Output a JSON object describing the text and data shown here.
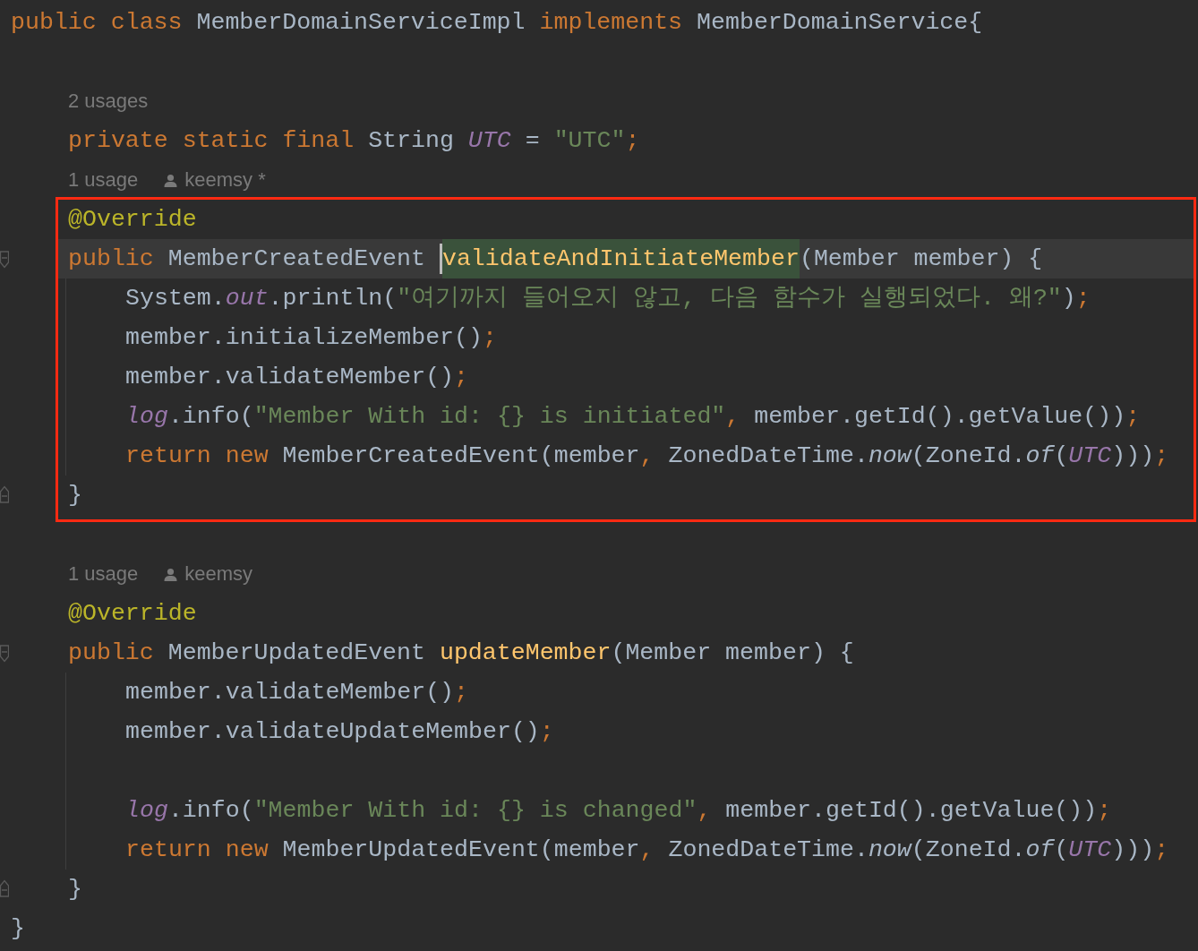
{
  "code": [
    {
      "kind": "code",
      "tokens": [
        {
          "kind": "keyword",
          "text": "public class "
        },
        {
          "kind": "plain",
          "text": "MemberDomainServiceImpl "
        },
        {
          "kind": "keyword",
          "text": "implements "
        },
        {
          "kind": "plain",
          "text": "MemberDomainService{"
        }
      ],
      "body": [
        {
          "kind": "blank"
        },
        {
          "kind": "hint",
          "usages": "2 usages"
        },
        {
          "kind": "code",
          "tokens": [
            {
              "kind": "keyword",
              "text": "private static final "
            },
            {
              "kind": "plain",
              "text": "String "
            },
            {
              "kind": "static-field",
              "text": "UTC"
            },
            {
              "kind": "plain",
              "text": " = "
            },
            {
              "kind": "string",
              "text": "\"UTC\""
            },
            {
              "kind": "punct",
              "text": ";"
            }
          ]
        },
        {
          "kind": "hint",
          "usages": "1 usage",
          "author": "keemsy *"
        },
        {
          "kind": "box",
          "children": [
            {
              "kind": "code",
              "tokens": [
                {
                  "kind": "annotation",
                  "text": "@Override"
                }
              ]
            },
            {
              "kind": "code",
              "current": true,
              "fold_start": true,
              "tokens": [
                {
                  "kind": "keyword",
                  "text": "public "
                },
                {
                  "kind": "plain",
                  "text": "MemberCreatedEvent "
                },
                {
                  "kind": "method-decl",
                  "text": "validateAndInitiateMember",
                  "highlighted": true,
                  "caret": true
                },
                {
                  "kind": "plain",
                  "text": "(Member member) {"
                }
              ],
              "body": [
                {
                  "kind": "code",
                  "tokens": [
                    {
                      "kind": "plain",
                      "text": "System."
                    },
                    {
                      "kind": "static-field",
                      "text": "out"
                    },
                    {
                      "kind": "plain",
                      "text": ".println("
                    },
                    {
                      "kind": "string",
                      "text": "\"여기까지 들어오지 않고, 다음 함수가 실행되었다. 왜?\""
                    },
                    {
                      "kind": "plain",
                      "text": ")"
                    },
                    {
                      "kind": "punct",
                      "text": ";"
                    }
                  ]
                },
                {
                  "kind": "code",
                  "tokens": [
                    {
                      "kind": "plain",
                      "text": "member.initializeMember()"
                    },
                    {
                      "kind": "punct",
                      "text": ";"
                    }
                  ]
                },
                {
                  "kind": "code",
                  "tokens": [
                    {
                      "kind": "plain",
                      "text": "member.validateMember()"
                    },
                    {
                      "kind": "punct",
                      "text": ";"
                    }
                  ]
                },
                {
                  "kind": "code",
                  "tokens": [
                    {
                      "kind": "static-field",
                      "text": "log"
                    },
                    {
                      "kind": "plain",
                      "text": ".info("
                    },
                    {
                      "kind": "string",
                      "text": "\"Member With id: {} is initiated\""
                    },
                    {
                      "kind": "punct",
                      "text": ", "
                    },
                    {
                      "kind": "plain",
                      "text": "member.getId().getValue())"
                    },
                    {
                      "kind": "punct",
                      "text": ";"
                    }
                  ]
                },
                {
                  "kind": "code",
                  "tokens": [
                    {
                      "kind": "keyword",
                      "text": "return new "
                    },
                    {
                      "kind": "plain",
                      "text": "MemberCreatedEvent(member"
                    },
                    {
                      "kind": "punct",
                      "text": ", "
                    },
                    {
                      "kind": "plain",
                      "text": "ZonedDateTime."
                    },
                    {
                      "kind": "static-call",
                      "text": "now"
                    },
                    {
                      "kind": "plain",
                      "text": "(ZoneId."
                    },
                    {
                      "kind": "static-call",
                      "text": "of"
                    },
                    {
                      "kind": "plain",
                      "text": "("
                    },
                    {
                      "kind": "static-field",
                      "text": "UTC"
                    },
                    {
                      "kind": "plain",
                      "text": ")))"
                    },
                    {
                      "kind": "punct",
                      "text": ";"
                    }
                  ]
                }
              ]
            },
            {
              "kind": "code",
              "fold_end": true,
              "tokens": [
                {
                  "kind": "plain",
                  "text": "}"
                }
              ]
            }
          ]
        },
        {
          "kind": "blank"
        },
        {
          "kind": "hint",
          "usages": "1 usage",
          "author": "keemsy"
        },
        {
          "kind": "code",
          "tokens": [
            {
              "kind": "annotation",
              "text": "@Override"
            }
          ]
        },
        {
          "kind": "code",
          "current": false,
          "fold_start": true,
          "tokens": [
            {
              "kind": "keyword",
              "text": "public "
            },
            {
              "kind": "plain",
              "text": "MemberUpdatedEvent "
            },
            {
              "kind": "method-decl",
              "text": "updateMember",
              "highlighted": false,
              "caret": false
            },
            {
              "kind": "plain",
              "text": "(Member member) {"
            }
          ],
          "body": [
            {
              "kind": "code",
              "tokens": [
                {
                  "kind": "plain",
                  "text": "member.validateMember()"
                },
                {
                  "kind": "punct",
                  "text": ";"
                }
              ]
            },
            {
              "kind": "code",
              "tokens": [
                {
                  "kind": "plain",
                  "text": "member.validateUpdateMember()"
                },
                {
                  "kind": "punct",
                  "text": ";"
                }
              ]
            },
            {
              "kind": "blank"
            },
            {
              "kind": "code",
              "tokens": [
                {
                  "kind": "static-field",
                  "text": "log"
                },
                {
                  "kind": "plain",
                  "text": ".info("
                },
                {
                  "kind": "string",
                  "text": "\"Member With id: {} is changed\""
                },
                {
                  "kind": "punct",
                  "text": ", "
                },
                {
                  "kind": "plain",
                  "text": "member.getId().getValue())"
                },
                {
                  "kind": "punct",
                  "text": ";"
                }
              ]
            },
            {
              "kind": "code",
              "tokens": [
                {
                  "kind": "keyword",
                  "text": "return new "
                },
                {
                  "kind": "plain",
                  "text": "MemberUpdatedEvent(member"
                },
                {
                  "kind": "punct",
                  "text": ", "
                },
                {
                  "kind": "plain",
                  "text": "ZonedDateTime."
                },
                {
                  "kind": "static-call",
                  "text": "now"
                },
                {
                  "kind": "plain",
                  "text": "(ZoneId."
                },
                {
                  "kind": "static-call",
                  "text": "of"
                },
                {
                  "kind": "plain",
                  "text": "("
                },
                {
                  "kind": "static-field",
                  "text": "UTC"
                },
                {
                  "kind": "plain",
                  "text": ")))"
                },
                {
                  "kind": "punct",
                  "text": ";"
                }
              ]
            }
          ]
        },
        {
          "kind": "code",
          "fold_end": true,
          "tokens": [
            {
              "kind": "plain",
              "text": "}"
            }
          ]
        }
      ]
    },
    {
      "kind": "code",
      "tokens": [
        {
          "kind": "plain",
          "text": "}"
        }
      ]
    }
  ]
}
